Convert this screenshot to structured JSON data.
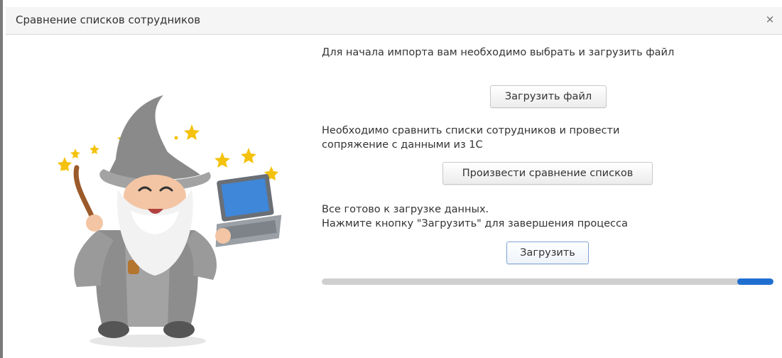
{
  "dialog": {
    "title": "Сравнение списков сотрудников",
    "close_glyph": "×"
  },
  "step1": {
    "text": "Для начала импорта вам необходимо выбрать и загрузить файл",
    "button_label": "Загрузить файл"
  },
  "step2": {
    "text_line1": "Необходимо сравнить списки сотрудников и провести",
    "text_line2": "сопряжение с данными из 1С",
    "button_label": "Произвести сравнение списков"
  },
  "step3": {
    "text_line1": "Все готово к загрузке данных.",
    "text_line2": "Нажмите кнопку \"Загрузить\" для завершения процесса",
    "button_label": "Загрузить"
  },
  "progress": {
    "fill_start_fraction": 0.92,
    "fill_end_fraction": 1.0,
    "track_color": "#cfcfcf",
    "fill_color": "#1f6fd1"
  },
  "illustration": {
    "icon": "wizard-with-laptop-illustration"
  }
}
